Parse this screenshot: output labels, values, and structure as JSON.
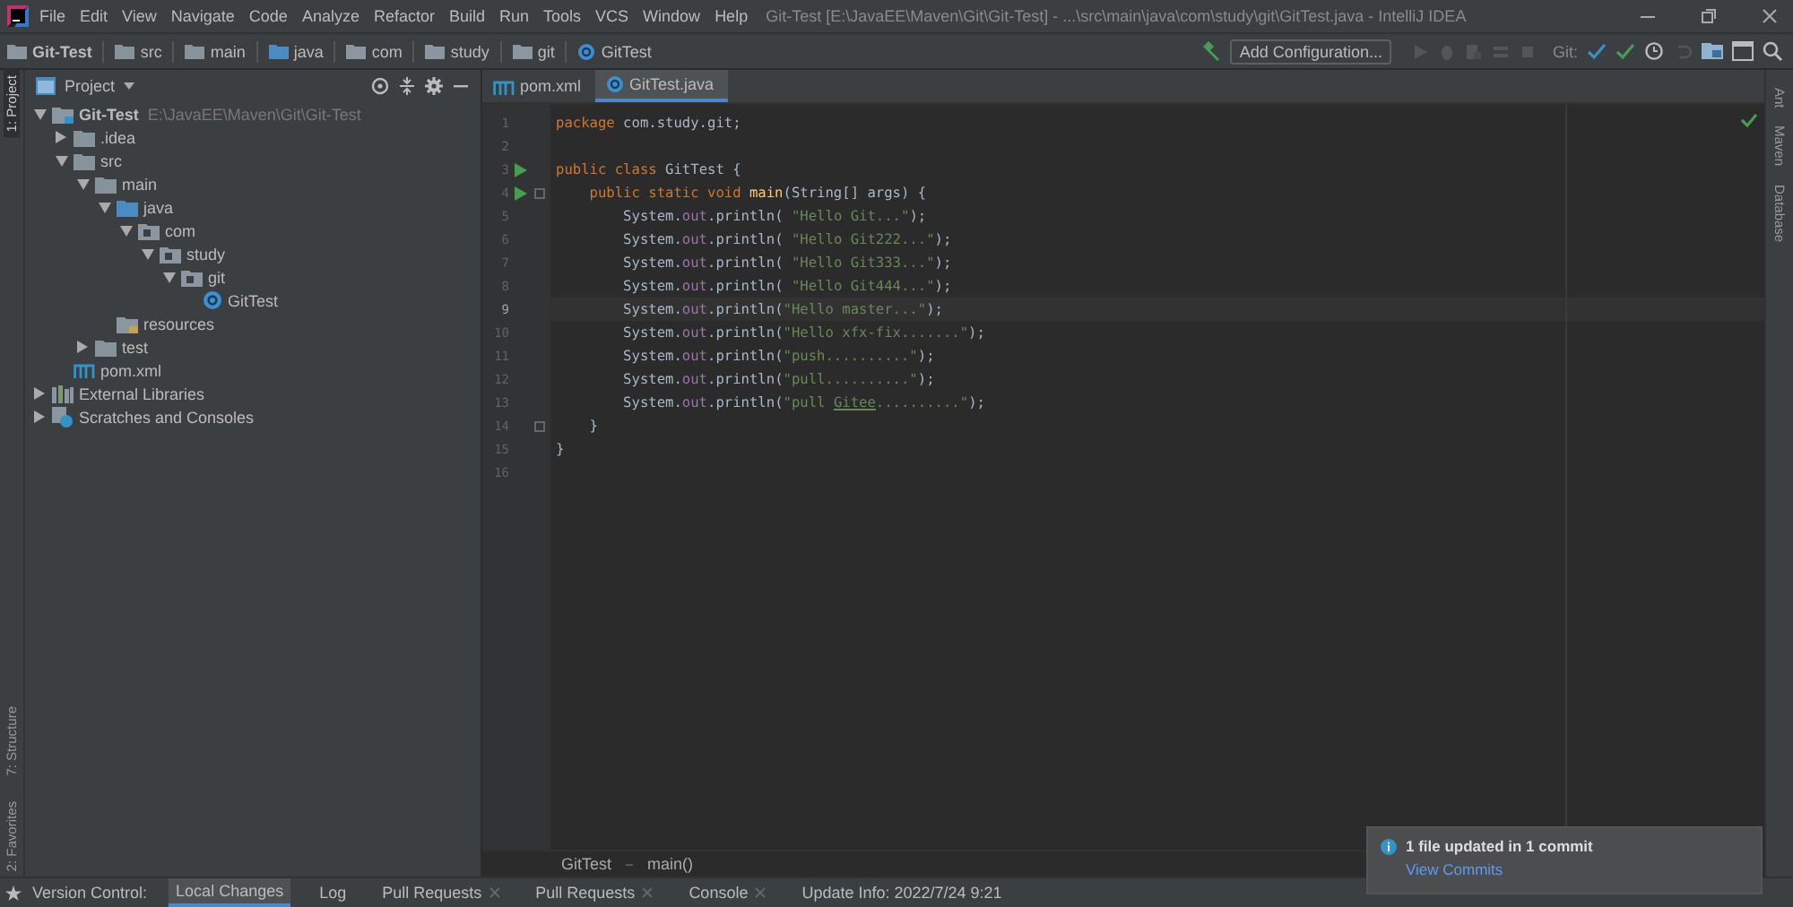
{
  "window": {
    "title": "Git-Test [E:\\JavaEE\\Maven\\Git\\Git-Test] - ...\\src\\main\\java\\com\\study\\git\\GitTest.java - IntelliJ IDEA",
    "menu": [
      "File",
      "Edit",
      "View",
      "Navigate",
      "Code",
      "Analyze",
      "Refactor",
      "Build",
      "Run",
      "Tools",
      "VCS",
      "Window",
      "Help"
    ]
  },
  "nav_bar": {
    "breadcrumbs": [
      {
        "label": "Git-Test",
        "kind": "module"
      },
      {
        "label": "src",
        "kind": "folder"
      },
      {
        "label": "main",
        "kind": "folder"
      },
      {
        "label": "java",
        "kind": "source"
      },
      {
        "label": "com",
        "kind": "package"
      },
      {
        "label": "study",
        "kind": "package"
      },
      {
        "label": "git",
        "kind": "package"
      },
      {
        "label": "GitTest",
        "kind": "class"
      }
    ],
    "run_config": "Add Configuration...",
    "git_label": "Git:"
  },
  "left_strip": {
    "top": [
      {
        "label": "1: Project",
        "selected": true
      }
    ],
    "bottom": [
      {
        "label": "7: Structure",
        "selected": false
      },
      {
        "label": "2: Favorites",
        "selected": false
      }
    ]
  },
  "right_strip": [
    "Ant",
    "Maven",
    "Database"
  ],
  "project": {
    "title": "Project",
    "tree": [
      {
        "label": "Git-Test",
        "kind": "module",
        "hint": "E:\\JavaEE\\Maven\\Git\\Git-Test",
        "expanded": true,
        "children": [
          {
            "label": ".idea",
            "kind": "folder",
            "expanded": false
          },
          {
            "label": "src",
            "kind": "folder",
            "expanded": true,
            "children": [
              {
                "label": "main",
                "kind": "folder",
                "expanded": true,
                "children": [
                  {
                    "label": "java",
                    "kind": "source",
                    "expanded": true,
                    "children": [
                      {
                        "label": "com",
                        "kind": "package",
                        "expanded": true,
                        "children": [
                          {
                            "label": "study",
                            "kind": "package",
                            "expanded": true,
                            "children": [
                              {
                                "label": "git",
                                "kind": "package",
                                "expanded": true,
                                "children": [
                                  {
                                    "label": "GitTest",
                                    "kind": "class"
                                  }
                                ]
                              }
                            ]
                          }
                        ]
                      }
                    ]
                  },
                  {
                    "label": "resources",
                    "kind": "resources"
                  }
                ]
              },
              {
                "label": "test",
                "kind": "folder",
                "expanded": false
              }
            ]
          },
          {
            "label": "pom.xml",
            "kind": "maven"
          }
        ]
      },
      {
        "label": "External Libraries",
        "kind": "libraries",
        "expanded": false
      },
      {
        "label": "Scratches and Consoles",
        "kind": "scratches",
        "expanded": false
      }
    ]
  },
  "editor": {
    "tabs": [
      {
        "label": "pom.xml",
        "kind": "maven",
        "selected": false
      },
      {
        "label": "GitTest.java",
        "kind": "class",
        "selected": true
      }
    ],
    "lines": [
      {
        "number": "1",
        "tokens": [
          {
            "kind": "keyword",
            "text": "package"
          },
          {
            "kind": "plain",
            "text": " com.study.git;"
          }
        ]
      },
      {
        "number": "2"
      },
      {
        "number": "3",
        "run": true,
        "tokens": [
          {
            "kind": "keyword",
            "text": "public class"
          },
          {
            "kind": "plain",
            "text": " GitTest {"
          }
        ]
      },
      {
        "number": "4",
        "run": true,
        "fold": true,
        "tokens": [
          {
            "kind": "keyword",
            "text": "    public static void"
          },
          {
            "kind": "method",
            "text": " main"
          },
          {
            "kind": "plain",
            "text": "(String[] args) {"
          }
        ]
      },
      {
        "number": "5",
        "tokens": [
          {
            "kind": "plain",
            "text": "        System."
          },
          {
            "kind": "field",
            "text": "out"
          },
          {
            "kind": "plain",
            "text": ".println( "
          },
          {
            "kind": "string",
            "text": "\"Hello Git...\""
          },
          {
            "kind": "plain",
            "text": ");"
          }
        ]
      },
      {
        "number": "6",
        "tokens": [
          {
            "kind": "plain",
            "text": "        System."
          },
          {
            "kind": "field",
            "text": "out"
          },
          {
            "kind": "plain",
            "text": ".println( "
          },
          {
            "kind": "string",
            "text": "\"Hello Git222...\""
          },
          {
            "kind": "plain",
            "text": ");"
          }
        ]
      },
      {
        "number": "7",
        "tokens": [
          {
            "kind": "plain",
            "text": "        System."
          },
          {
            "kind": "field",
            "text": "out"
          },
          {
            "kind": "plain",
            "text": ".println( "
          },
          {
            "kind": "string",
            "text": "\"Hello Git333...\""
          },
          {
            "kind": "plain",
            "text": ");"
          }
        ]
      },
      {
        "number": "8",
        "tokens": [
          {
            "kind": "plain",
            "text": "        System."
          },
          {
            "kind": "field",
            "text": "out"
          },
          {
            "kind": "plain",
            "text": ".println( "
          },
          {
            "kind": "string",
            "text": "\"Hello Git444...\""
          },
          {
            "kind": "plain",
            "text": ");"
          }
        ]
      },
      {
        "number": "9",
        "current": true,
        "tokens": [
          {
            "kind": "plain",
            "text": "        System."
          },
          {
            "kind": "field",
            "text": "out"
          },
          {
            "kind": "plain",
            "text": ".println("
          },
          {
            "kind": "string",
            "text": "\"Hello master...\""
          },
          {
            "kind": "plain",
            "text": ");"
          }
        ]
      },
      {
        "number": "10",
        "tokens": [
          {
            "kind": "plain",
            "text": "        System."
          },
          {
            "kind": "field",
            "text": "out"
          },
          {
            "kind": "plain",
            "text": ".println("
          },
          {
            "kind": "string",
            "text": "\"Hello xfx-fix.......\""
          },
          {
            "kind": "plain",
            "text": ");"
          }
        ]
      },
      {
        "number": "11",
        "tokens": [
          {
            "kind": "plain",
            "text": "        System."
          },
          {
            "kind": "field",
            "text": "out"
          },
          {
            "kind": "plain",
            "text": ".println("
          },
          {
            "kind": "string",
            "text": "\"push..........\""
          },
          {
            "kind": "plain",
            "text": ");"
          }
        ]
      },
      {
        "number": "12",
        "tokens": [
          {
            "kind": "plain",
            "text": "        System."
          },
          {
            "kind": "field",
            "text": "out"
          },
          {
            "kind": "plain",
            "text": ".println("
          },
          {
            "kind": "string",
            "text": "\"pull..........\""
          },
          {
            "kind": "plain",
            "text": ");"
          }
        ]
      },
      {
        "number": "13",
        "tokens": [
          {
            "kind": "plain",
            "text": "        System."
          },
          {
            "kind": "field",
            "text": "out"
          },
          {
            "kind": "plain",
            "text": ".println("
          },
          {
            "kind": "string",
            "text": "\"pull "
          },
          {
            "kind": "typo",
            "text": "Gitee"
          },
          {
            "kind": "string",
            "text": "..........\""
          },
          {
            "kind": "plain",
            "text": ");"
          }
        ]
      },
      {
        "number": "14",
        "fold": true,
        "tokens": [
          {
            "kind": "plain",
            "text": "    }"
          }
        ]
      },
      {
        "number": "15",
        "tokens": [
          {
            "kind": "plain",
            "text": "}"
          }
        ]
      },
      {
        "number": "16"
      }
    ],
    "breadcrumbs": [
      "GitTest",
      "main()"
    ]
  },
  "status_bar": {
    "label": "Version Control:",
    "tabs": [
      {
        "label": "Local Changes",
        "selected": true,
        "closable": false
      },
      {
        "label": "Log",
        "selected": false,
        "closable": false
      },
      {
        "label": "Pull Requests",
        "selected": false,
        "closable": true
      },
      {
        "label": "Pull Requests",
        "selected": false,
        "closable": true
      },
      {
        "label": "Console",
        "selected": false,
        "closable": true
      },
      {
        "label": "Update Info: 2022/7/24 9:21",
        "selected": false,
        "closable": false
      }
    ]
  },
  "notification": {
    "message": "1 file updated in 1 commit",
    "link": "View Commits"
  }
}
